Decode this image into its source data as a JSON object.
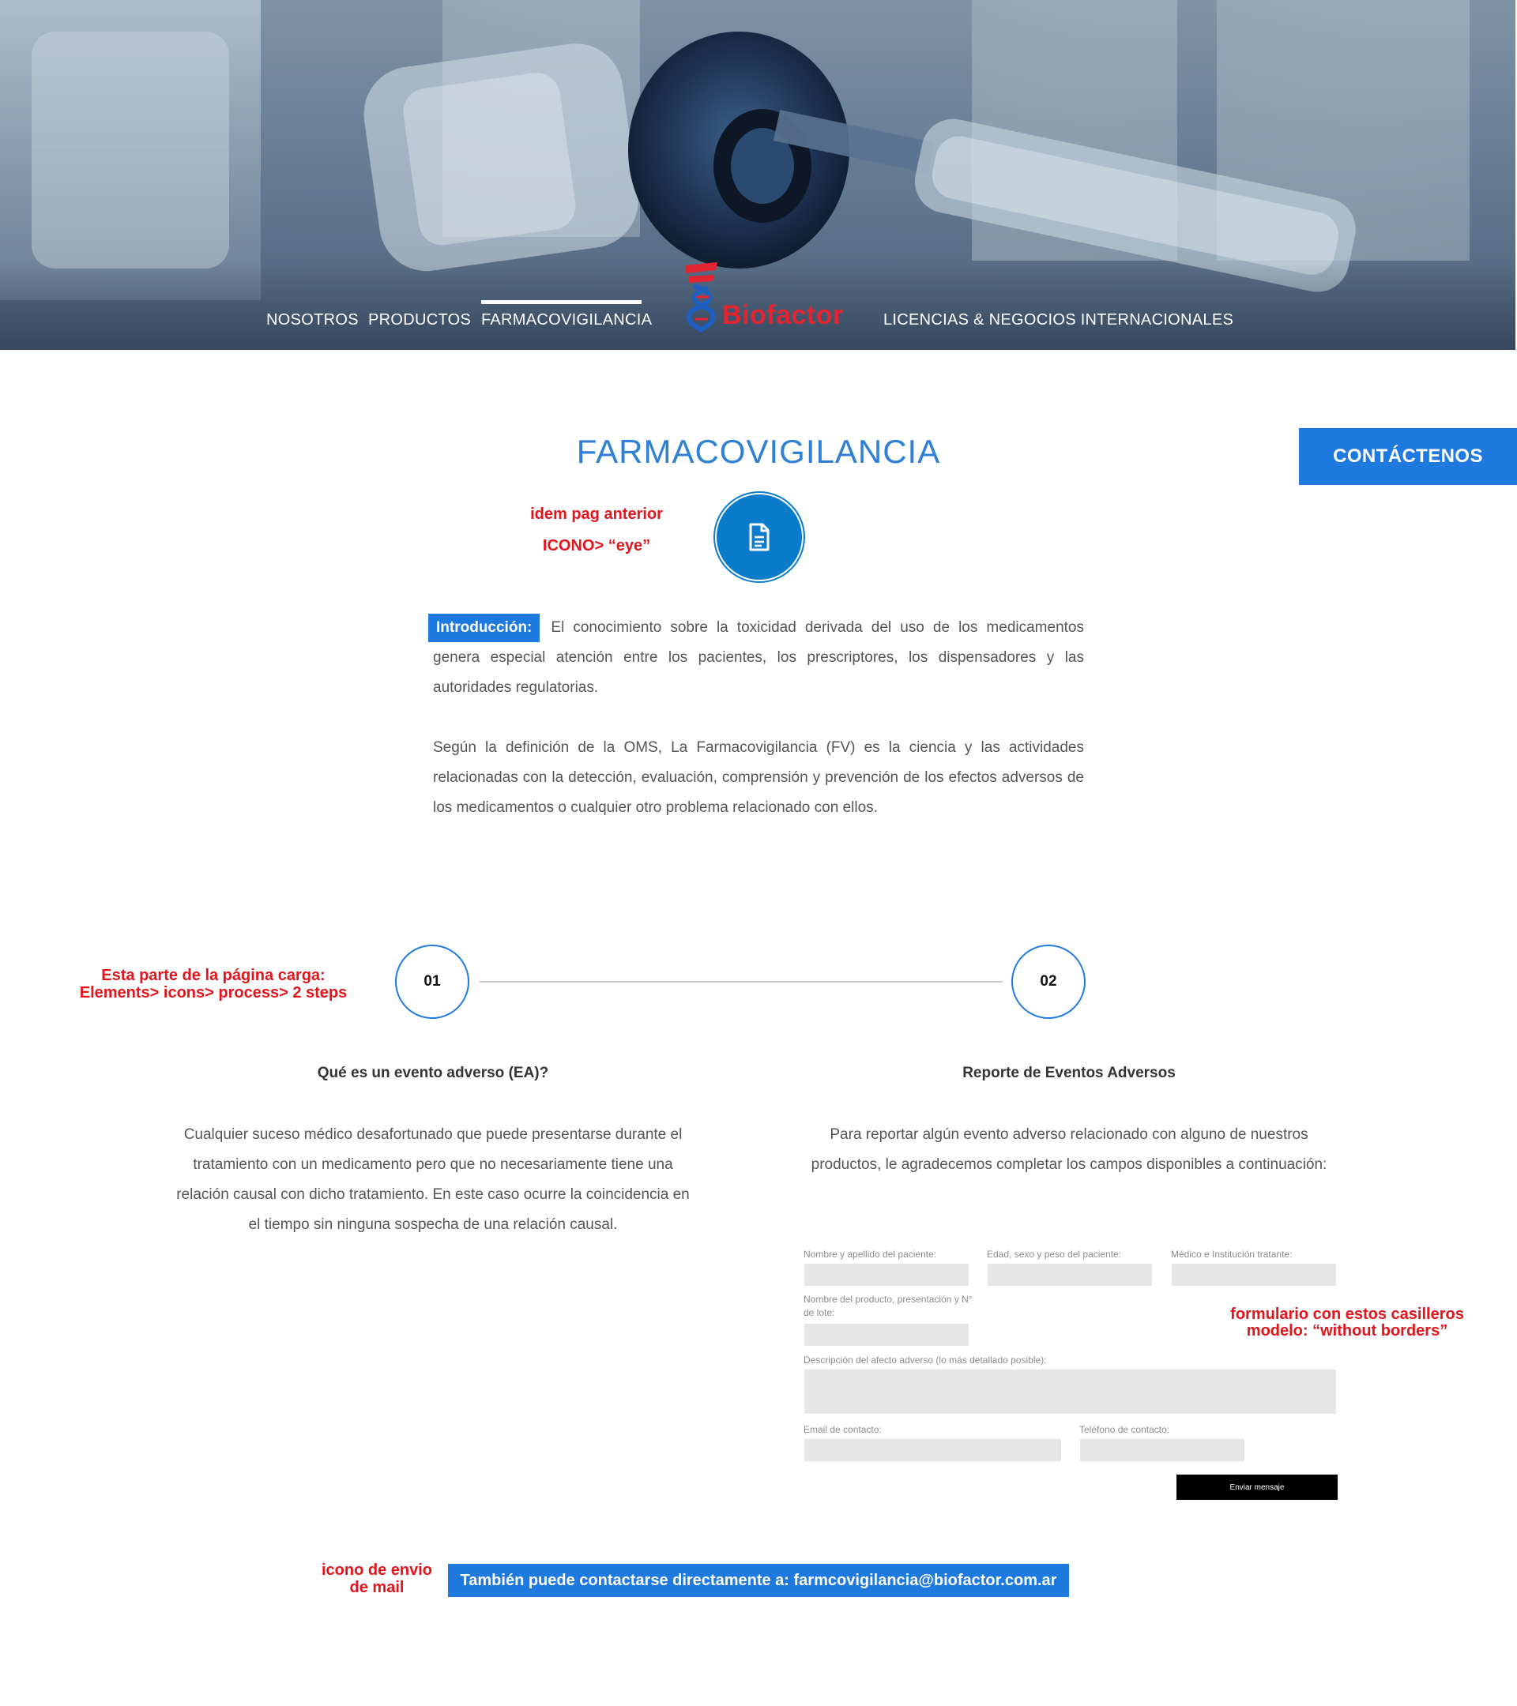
{
  "nav": {
    "items": [
      "NOSOTROS",
      "PRODUCTOS",
      "FARMACOVIGILANCIA",
      "LICENCIAS & NEGOCIOS INTERNACIONALES"
    ],
    "active": "FARMACOVIGILANCIA"
  },
  "logo": {
    "text": "Biofactor",
    "color": "#e22530"
  },
  "contact_button": "CONTÁCTENOS",
  "page_title": "FARMACOVIGILANCIA",
  "notes": {
    "icon_note_line1": "idem pag anterior",
    "icon_note_line2": "ICONO> “eye”",
    "process_note_line1": "Esta parte de la página carga:",
    "process_note_line2": "Elements> icons> process> 2 steps",
    "form_note_line1": "formulario con estos casilleros",
    "form_note_line2": "modelo: “without borders”",
    "mail_note_line1": "icono de envio",
    "mail_note_line2": "de mail"
  },
  "intro": {
    "tag": "Introducción:",
    "paragraph1": "El conocimiento sobre la toxicidad derivada del uso de los medicamentos genera especial atención entre los pacientes, los prescriptores, los dispensadores y las autoridades regulatorias.",
    "paragraph2": "Según la definición de la OMS, La Farmacovigilancia (FV) es la ciencia y las actividades relacionadas con la detección, evaluación, comprensión y prevención de los efectos adversos de los medicamentos o cualquier otro problema relacionado con ellos."
  },
  "process": {
    "step1": {
      "number": "01",
      "title": "Qué es un evento adverso (EA)?",
      "text": "Cualquier suceso médico desafortunado que puede presentarse durante el tratamiento con un medicamento pero que no necesariamente tiene una relación causal con dicho tratamiento. En este caso ocurre la coincidencia en el tiempo sin ninguna sospecha de una relación causal."
    },
    "step2": {
      "number": "02",
      "title": "Reporte de Eventos Adversos",
      "text": "Para reportar algún evento adverso relacionado con alguno de nuestros productos, le agradecemos  completar los campos disponibles a continuación:"
    }
  },
  "form": {
    "patient_name_label": "Nombre y apellido del paciente:",
    "age_label": "Edad, sexo y peso del paciente:",
    "doctor_label": "Médico e Institución tratante:",
    "product_label": "Nombre del producto, presentación y N° de lote:",
    "description_label": "Descripción del afecto adverso (lo más detallado posible):",
    "email_label": "Email de contacto:",
    "phone_label": "Teléfono de contacto:",
    "submit_label": "Enviar mensaje"
  },
  "mail_bar": "También puede contactarse directamente a: farmcovigilancia@biofactor.com.ar",
  "colors": {
    "accent": "#1f7ae0",
    "note_red": "#e3141b",
    "field_bg": "#e6e6e6"
  }
}
